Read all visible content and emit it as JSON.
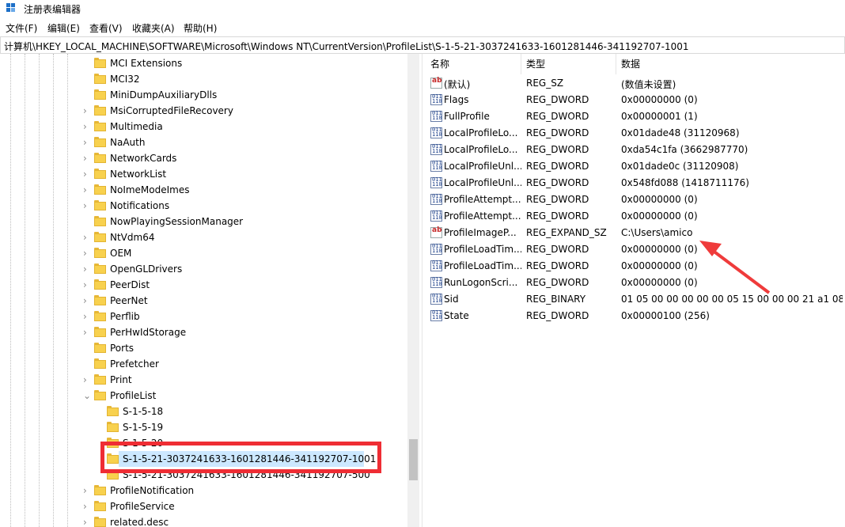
{
  "window": {
    "title": "注册表编辑器"
  },
  "menu": [
    "文件(F)",
    "编辑(E)",
    "查看(V)",
    "收藏夹(A)",
    "帮助(H)"
  ],
  "address": "计算机\\HKEY_LOCAL_MACHINE\\SOFTWARE\\Microsoft\\Windows NT\\CurrentVersion\\ProfileList\\S-1-5-21-3037241633-1601281446-341192707-1001",
  "tree": {
    "items": [
      {
        "label": "MCI Extensions",
        "expander": ""
      },
      {
        "label": "MCI32",
        "expander": ""
      },
      {
        "label": "MiniDumpAuxiliaryDlls",
        "expander": ""
      },
      {
        "label": "MsiCorruptedFileRecovery",
        "expander": ">"
      },
      {
        "label": "Multimedia",
        "expander": ">"
      },
      {
        "label": "NaAuth",
        "expander": ">"
      },
      {
        "label": "NetworkCards",
        "expander": ">"
      },
      {
        "label": "NetworkList",
        "expander": ">"
      },
      {
        "label": "NoImeModeImes",
        "expander": ">"
      },
      {
        "label": "Notifications",
        "expander": ">"
      },
      {
        "label": "NowPlayingSessionManager",
        "expander": ""
      },
      {
        "label": "NtVdm64",
        "expander": ">"
      },
      {
        "label": "OEM",
        "expander": ">"
      },
      {
        "label": "OpenGLDrivers",
        "expander": ">"
      },
      {
        "label": "PeerDist",
        "expander": ">"
      },
      {
        "label": "PeerNet",
        "expander": ">"
      },
      {
        "label": "Perflib",
        "expander": ">"
      },
      {
        "label": "PerHwIdStorage",
        "expander": ">"
      },
      {
        "label": "Ports",
        "expander": ""
      },
      {
        "label": "Prefetcher",
        "expander": ""
      },
      {
        "label": "Print",
        "expander": ">"
      },
      {
        "label": "ProfileList",
        "expander": "v"
      }
    ],
    "children": [
      {
        "label": "S-1-5-18"
      },
      {
        "label": "S-1-5-19"
      },
      {
        "label": "S-1-5-20"
      },
      {
        "label": "S-1-5-21-3037241633-1601281446-341192707-1001"
      },
      {
        "label": "S-1-5-21-3037241633-1601281446-341192707-500"
      }
    ],
    "after": [
      {
        "label": "ProfileNotification",
        "expander": ">"
      },
      {
        "label": "ProfileService",
        "expander": ">"
      },
      {
        "label": "related.desc",
        "expander": ">"
      }
    ]
  },
  "values": {
    "headers": [
      "名称",
      "类型",
      "数据"
    ],
    "rows": [
      {
        "icon": "string-value-icon",
        "name": "(默认)",
        "type": "REG_SZ",
        "data": "(数值未设置)"
      },
      {
        "icon": "binary-value-icon",
        "name": "Flags",
        "type": "REG_DWORD",
        "data": "0x00000000 (0)"
      },
      {
        "icon": "binary-value-icon",
        "name": "FullProfile",
        "type": "REG_DWORD",
        "data": "0x00000001 (1)"
      },
      {
        "icon": "binary-value-icon",
        "name": "LocalProfileLo...",
        "type": "REG_DWORD",
        "data": "0x01dade48 (31120968)"
      },
      {
        "icon": "binary-value-icon",
        "name": "LocalProfileLo...",
        "type": "REG_DWORD",
        "data": "0xda54c1fa (3662987770)"
      },
      {
        "icon": "binary-value-icon",
        "name": "LocalProfileUnl...",
        "type": "REG_DWORD",
        "data": "0x01dade0c (31120908)"
      },
      {
        "icon": "binary-value-icon",
        "name": "LocalProfileUnl...",
        "type": "REG_DWORD",
        "data": "0x548fd088 (1418711176)"
      },
      {
        "icon": "binary-value-icon",
        "name": "ProfileAttempt...",
        "type": "REG_DWORD",
        "data": "0x00000000 (0)"
      },
      {
        "icon": "binary-value-icon",
        "name": "ProfileAttempt...",
        "type": "REG_DWORD",
        "data": "0x00000000 (0)"
      },
      {
        "icon": "string-value-icon",
        "name": "ProfileImageP...",
        "type": "REG_EXPAND_SZ",
        "data": "C:\\Users\\amico"
      },
      {
        "icon": "binary-value-icon",
        "name": "ProfileLoadTim...",
        "type": "REG_DWORD",
        "data": "0x00000000 (0)"
      },
      {
        "icon": "binary-value-icon",
        "name": "ProfileLoadTim...",
        "type": "REG_DWORD",
        "data": "0x00000000 (0)"
      },
      {
        "icon": "binary-value-icon",
        "name": "RunLogonScri...",
        "type": "REG_DWORD",
        "data": "0x00000000 (0)"
      },
      {
        "icon": "binary-value-icon",
        "name": "Sid",
        "type": "REG_BINARY",
        "data": "01 05 00 00 00 00 00 05 15 00 00 00 21 a1 08..."
      },
      {
        "icon": "binary-value-icon",
        "name": "State",
        "type": "REG_DWORD",
        "data": "0x00000100 (256)"
      }
    ]
  },
  "colors": {
    "highlight": "#ef2d34",
    "selection": "#cce8ff",
    "folder": "#f8d14e"
  }
}
